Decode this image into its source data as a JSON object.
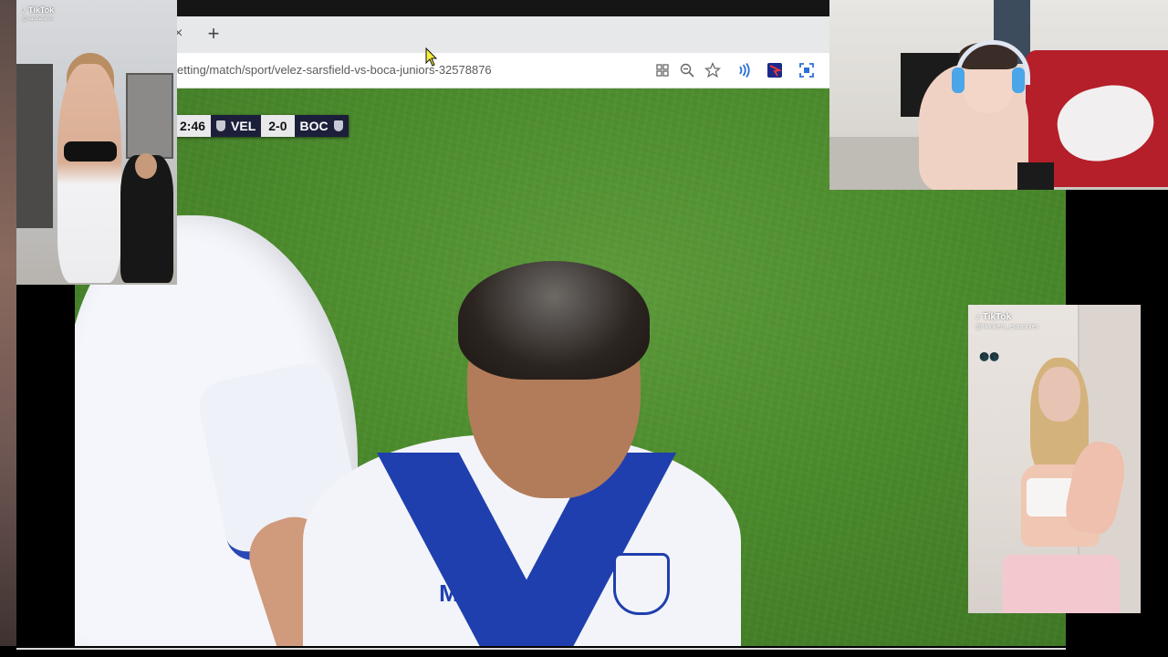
{
  "browser": {
    "url": "etting/match/sport/velez-sarsfield-vs-boca-juniors-32578876",
    "tab_close_glyph": "×",
    "new_tab_glyph": "+",
    "toolbar_icons": [
      "apps-icon",
      "zoom-out-icon",
      "favorite-star-icon",
      "read-aloud-icon",
      "extension-icon",
      "screenshot-icon"
    ]
  },
  "scoreboard": {
    "time": "2:46",
    "home_team": "VEL",
    "score": "2-0",
    "away_team": "BOC"
  },
  "tiktok_left": {
    "brand": "TikTok",
    "username": "@sashaferro"
  },
  "tiktok_right": {
    "brand": "TikTok",
    "username": "@tiktokers_espanoles",
    "emoji": "🌑🌑"
  },
  "colors": {
    "jersey_blue": "#1f3fae",
    "pitch_green": "#4b8a2c",
    "scoreboard_dark": "#1c1f3a",
    "bed_red": "#b51f2a",
    "headset_blue": "#4aa6e8"
  }
}
